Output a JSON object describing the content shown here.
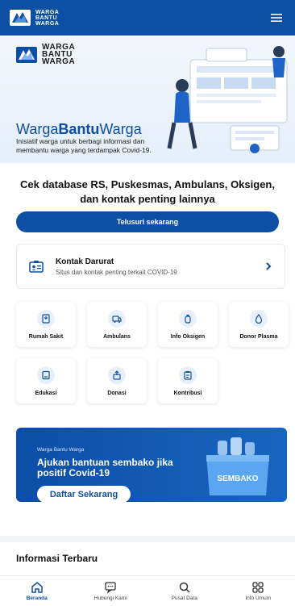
{
  "app": {
    "logo_line1": "WARGA",
    "logo_line2": "BANTU",
    "logo_line3": "WARGA"
  },
  "hero": {
    "logo_line1": "WARGA",
    "logo_line2": "BANTU",
    "logo_line3": "WARGA",
    "title_part1": "Warga",
    "title_part2": "Bantu",
    "title_part3": "Warga",
    "description": "Inisiatif warga untuk berbagi informasi dan membantu warga yang terdampak Covid-19."
  },
  "headline": "Cek database RS, Puskesmas, Ambulans, Oksigen, dan kontak penting lainnya",
  "cta_label": "Telusuri sekarang",
  "contact": {
    "title": "Kontak Darurat",
    "subtitle": "Situs dan kontak penting terkait COVID-19",
    "icon": "contact-card-icon"
  },
  "quick_links": [
    {
      "label": "Rumah Sakit",
      "icon": "hospital-icon"
    },
    {
      "label": "Ambulans",
      "icon": "ambulance-icon"
    },
    {
      "label": "Info Oksigen",
      "icon": "oxygen-icon"
    },
    {
      "label": "Donor Plasma",
      "icon": "plasma-icon"
    },
    {
      "label": "Edukasi",
      "icon": "education-icon"
    },
    {
      "label": "Donasi",
      "icon": "donation-icon"
    },
    {
      "label": "Kontribusi",
      "icon": "contribution-icon"
    }
  ],
  "banner": {
    "kicker": "Warga Bantu Warga",
    "title": "Ajukan bantuan sembako jika positif Covid-19",
    "button": "Daftar Sekarang",
    "box_label": "SEMBAKO"
  },
  "section_title": "Informasi Terbaru",
  "nav": [
    {
      "label": "Beranda",
      "icon": "home-icon",
      "active": true
    },
    {
      "label": "Hubungi Kami",
      "icon": "chat-icon",
      "active": false
    },
    {
      "label": "Pusat Data",
      "icon": "search-icon",
      "active": false
    },
    {
      "label": "Info Umum",
      "icon": "grid-icon",
      "active": false
    }
  ],
  "colors": {
    "primary": "#0d4fa3",
    "surface": "#ffffff",
    "tile_icon_bg": "#e8f0fb"
  }
}
